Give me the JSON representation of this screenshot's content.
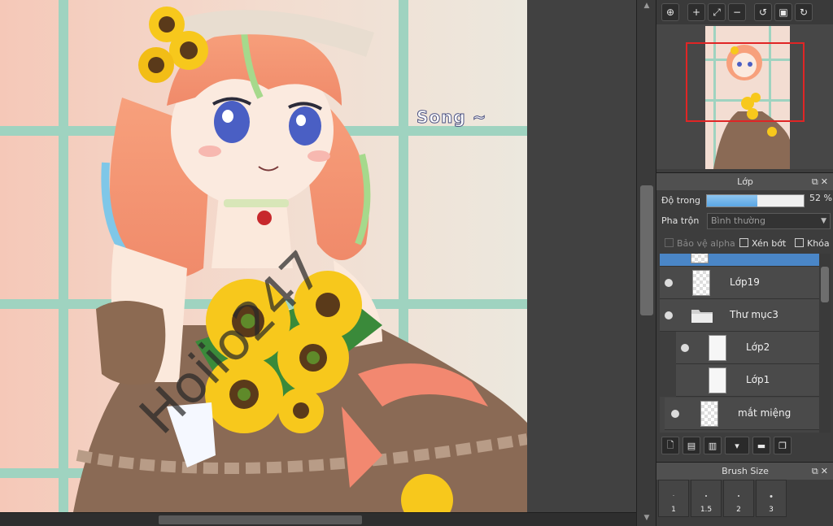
{
  "canvas": {
    "signature_text": "Song ~",
    "watermark_text": "Hoiio247"
  },
  "navigator": {
    "toolbar": [
      {
        "name": "zoom-fit-icon",
        "glyph": "⊕"
      },
      {
        "name": "zoom-in-icon",
        "glyph": "+"
      },
      {
        "name": "fit-screen-icon",
        "glyph": "⤢"
      },
      {
        "name": "zoom-out-icon",
        "glyph": "−"
      },
      {
        "name": "rotate-left-icon",
        "glyph": "↺"
      },
      {
        "name": "actual-size-icon",
        "glyph": "▣"
      },
      {
        "name": "rotate-right-icon",
        "glyph": "↻"
      }
    ]
  },
  "layer_panel": {
    "title": "Lớp",
    "opacity_label": "Độ trong",
    "opacity_value": "52 %",
    "opacity_fraction": 0.52,
    "blend_label": "Pha trộn",
    "blend_value": "Bình thường",
    "protect_alpha_label": "Bảo vệ alpha",
    "clipping_label": "Xén bớt",
    "lock_label": "Khóa",
    "layers": [
      {
        "name": "",
        "selected": true
      },
      {
        "name": "Lớp19",
        "selected": false
      },
      {
        "name": "Thư mục3",
        "selected": false,
        "folder": true
      },
      {
        "name": "Lớp2",
        "selected": false,
        "indent": true
      },
      {
        "name": "Lớp1",
        "selected": false,
        "indent": true
      },
      {
        "name": "mắt miệng",
        "selected": false
      }
    ]
  },
  "brush_panel": {
    "title": "Brush Size",
    "sizes": [
      "1",
      "1.5",
      "2",
      "3"
    ]
  },
  "colors": {
    "accent": "#4a86c7",
    "nav_rect": "#e02525"
  }
}
